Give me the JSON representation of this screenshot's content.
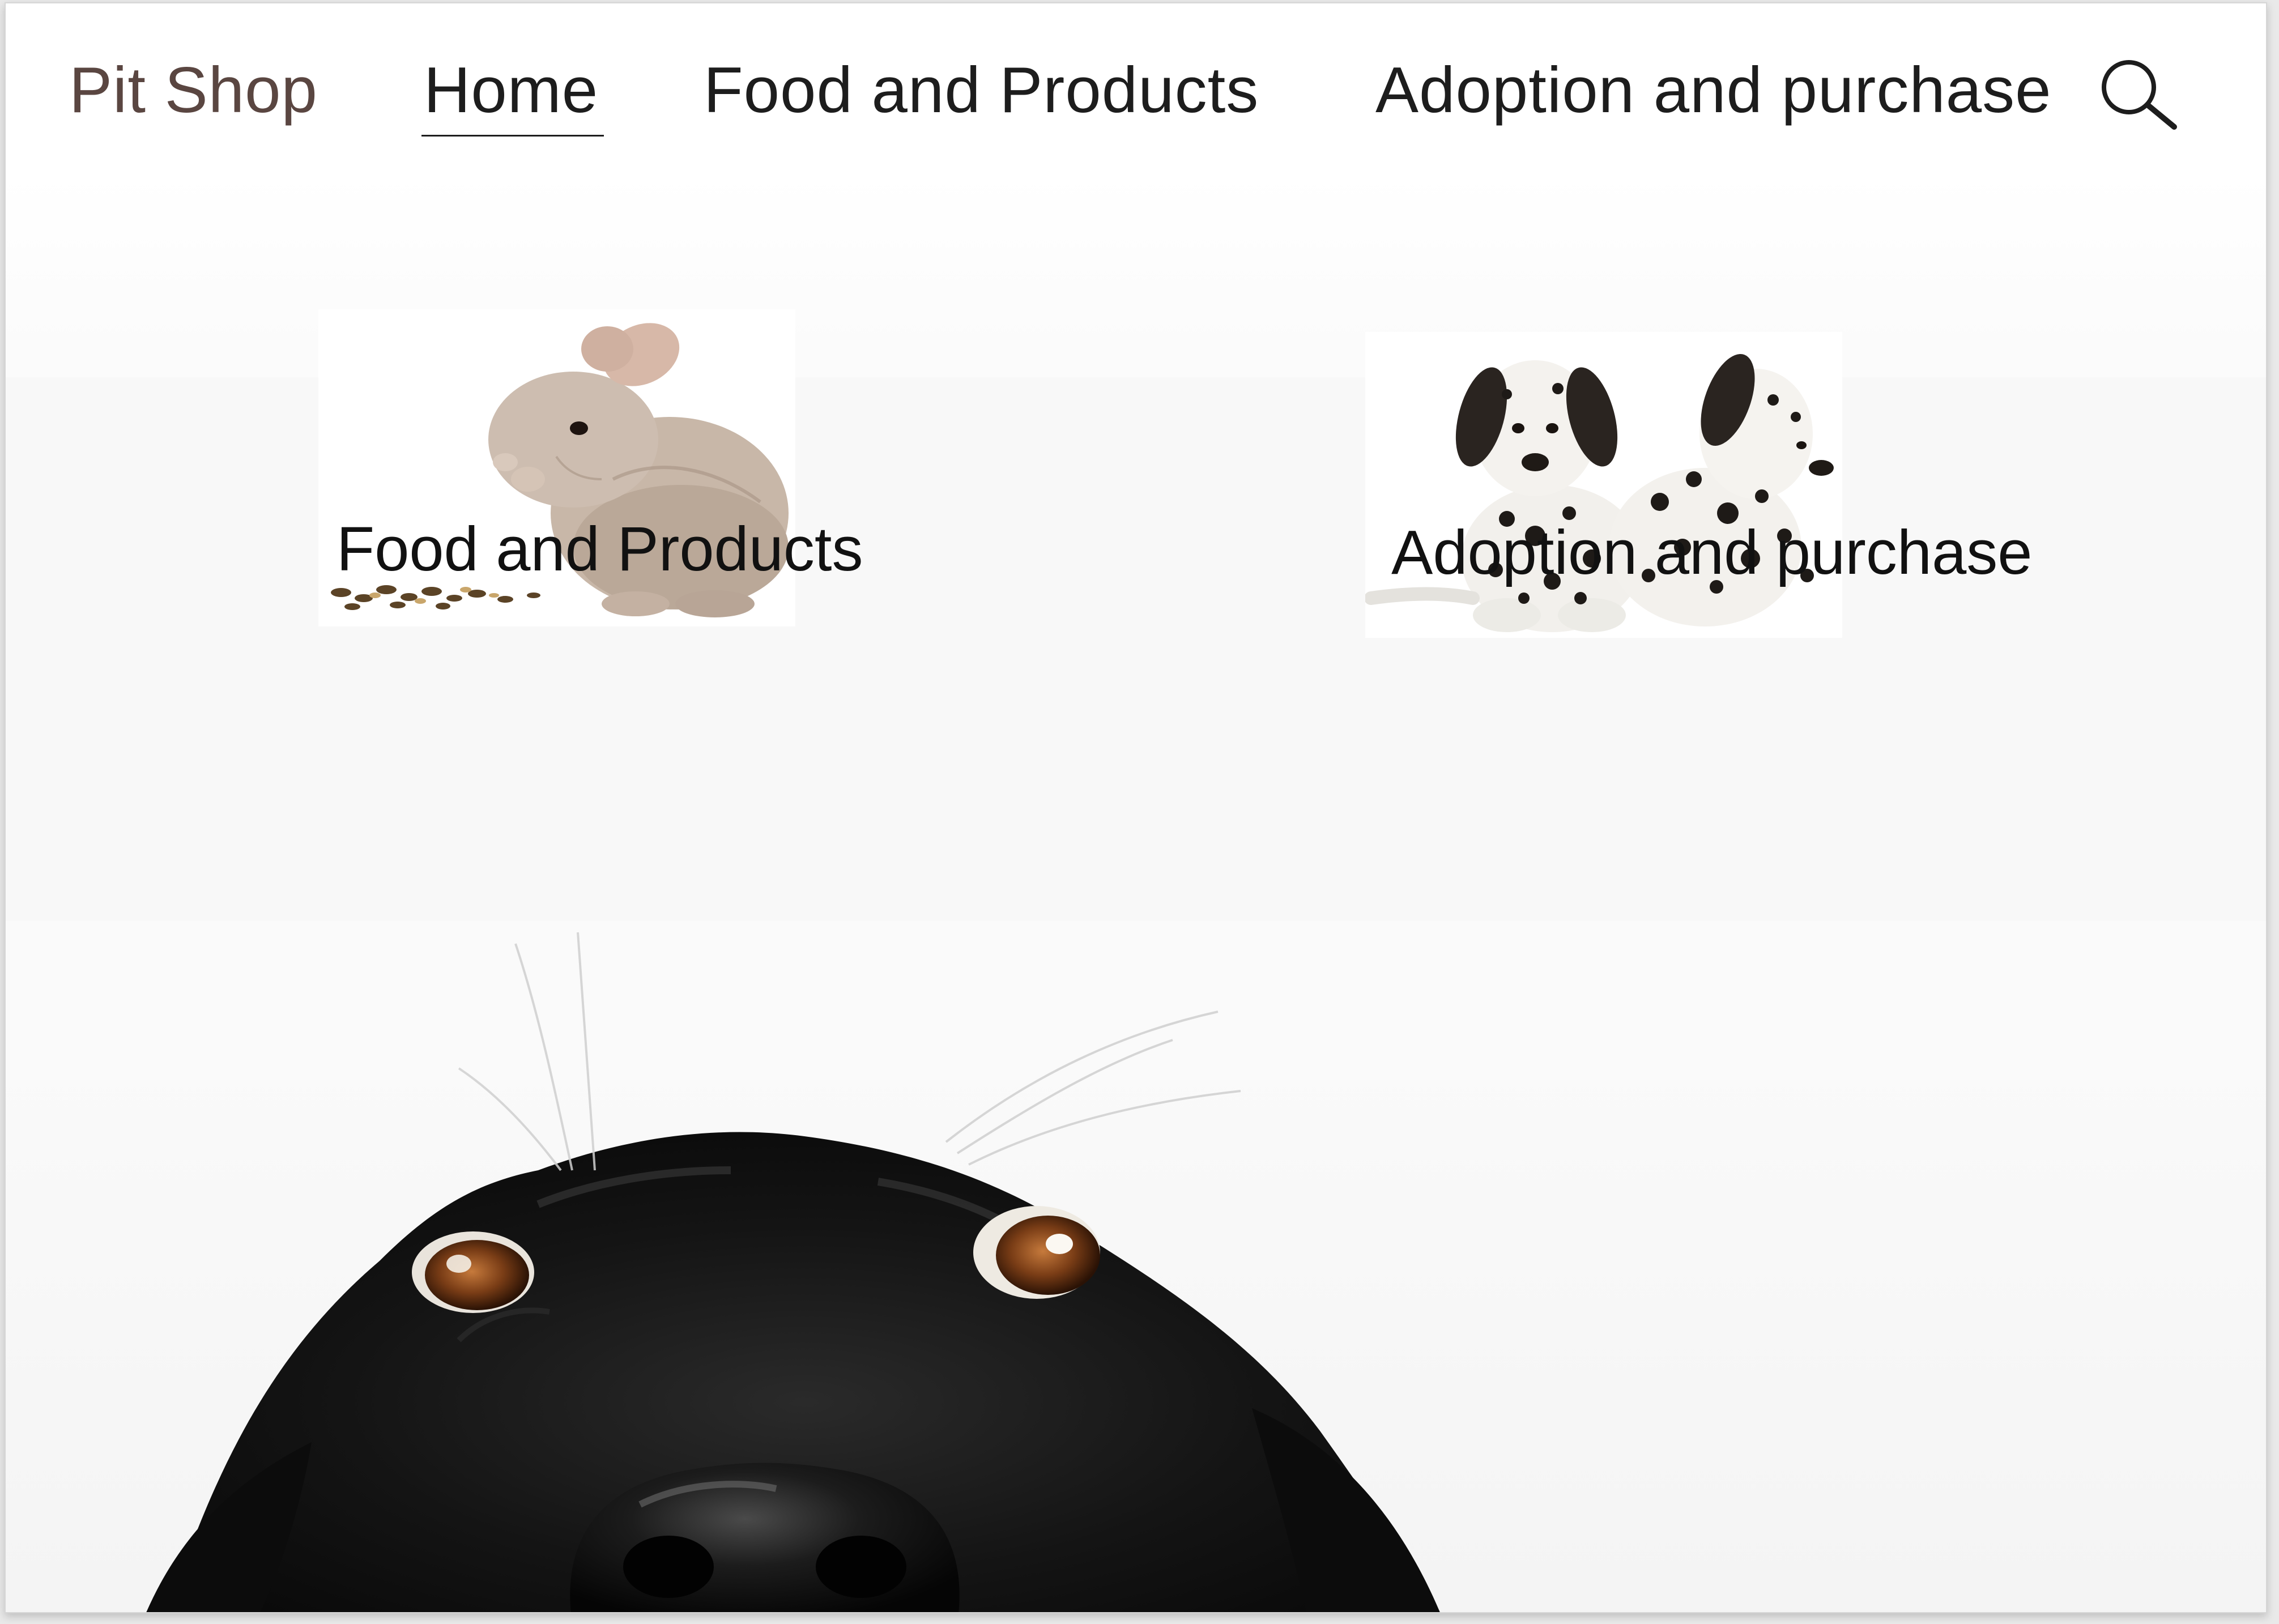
{
  "header": {
    "brand": "Pit Shop",
    "nav": [
      {
        "label": "Home",
        "active": true
      },
      {
        "label": "Food and Products",
        "active": false
      },
      {
        "label": "Adoption and purchase",
        "active": false
      }
    ],
    "search_icon": "search-icon"
  },
  "categories": [
    {
      "label": "Food and Products",
      "image": "chinchilla-eating-seeds"
    },
    {
      "label": "Adoption and purchase",
      "image": "dalmatian-puppies"
    }
  ],
  "hero": {
    "image": "black-dog-peeking"
  },
  "colors": {
    "brand": "#5a4641",
    "nav_text": "#1d1d1d",
    "label_text": "#111111",
    "background": "#ffffff"
  }
}
